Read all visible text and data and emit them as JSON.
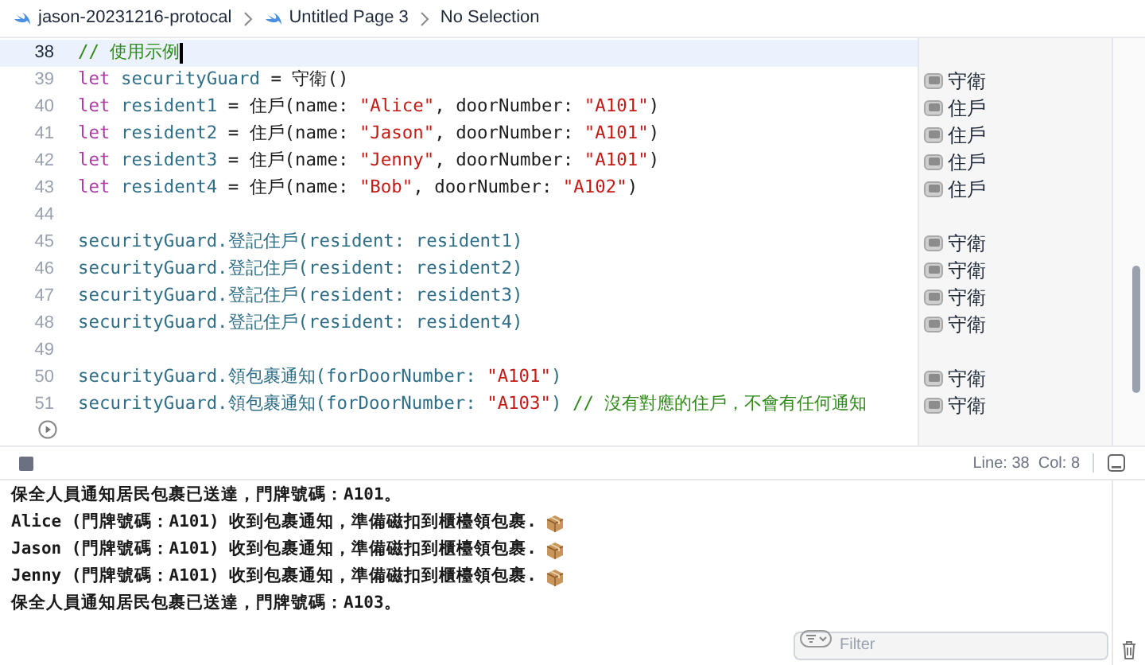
{
  "breadcrumb": [
    {
      "label": "jason-20231216-protocal",
      "icon": true
    },
    {
      "label": "Untitled Page 3",
      "icon": true
    },
    {
      "label": "No Selection",
      "icon": false
    }
  ],
  "editor": {
    "lines": [
      {
        "number": "38",
        "selected": true,
        "cursor": true,
        "tokens": [
          {
            "kind": "comment",
            "text": "// 使用示例"
          }
        ]
      },
      {
        "number": "39",
        "selected": false,
        "tokens": [
          {
            "kind": "keyword",
            "text": "let "
          },
          {
            "kind": "identifier",
            "text": "securityGuard"
          },
          {
            "kind": "plain",
            "text": " = 守衛()"
          }
        ],
        "result": "守衛"
      },
      {
        "number": "40",
        "selected": false,
        "tokens": [
          {
            "kind": "keyword",
            "text": "let "
          },
          {
            "kind": "identifier",
            "text": "resident1"
          },
          {
            "kind": "plain",
            "text": " = 住戶(name: "
          },
          {
            "kind": "string",
            "text": "\"Alice\""
          },
          {
            "kind": "plain",
            "text": ", doorNumber: "
          },
          {
            "kind": "string",
            "text": "\"A101\""
          },
          {
            "kind": "plain",
            "text": ")"
          }
        ],
        "result": "住戶"
      },
      {
        "number": "41",
        "selected": false,
        "tokens": [
          {
            "kind": "keyword",
            "text": "let "
          },
          {
            "kind": "identifier",
            "text": "resident2"
          },
          {
            "kind": "plain",
            "text": " = 住戶(name: "
          },
          {
            "kind": "string",
            "text": "\"Jason\""
          },
          {
            "kind": "plain",
            "text": ", doorNumber: "
          },
          {
            "kind": "string",
            "text": "\"A101\""
          },
          {
            "kind": "plain",
            "text": ")"
          }
        ],
        "result": "住戶"
      },
      {
        "number": "42",
        "selected": false,
        "tokens": [
          {
            "kind": "keyword",
            "text": "let "
          },
          {
            "kind": "identifier",
            "text": "resident3"
          },
          {
            "kind": "plain",
            "text": " = 住戶(name: "
          },
          {
            "kind": "string",
            "text": "\"Jenny\""
          },
          {
            "kind": "plain",
            "text": ", doorNumber: "
          },
          {
            "kind": "string",
            "text": "\"A101\""
          },
          {
            "kind": "plain",
            "text": ")"
          }
        ],
        "result": "住戶"
      },
      {
        "number": "43",
        "selected": false,
        "tokens": [
          {
            "kind": "keyword",
            "text": "let "
          },
          {
            "kind": "identifier",
            "text": "resident4"
          },
          {
            "kind": "plain",
            "text": " = 住戶(name: "
          },
          {
            "kind": "string",
            "text": "\"Bob\""
          },
          {
            "kind": "plain",
            "text": ", doorNumber: "
          },
          {
            "kind": "string",
            "text": "\"A102\""
          },
          {
            "kind": "plain",
            "text": ")"
          }
        ],
        "result": "住戶"
      },
      {
        "number": "44",
        "selected": false
      },
      {
        "number": "45",
        "selected": false,
        "tokens": [
          {
            "kind": "call",
            "text": "securityGuard.登記住戶(resident: resident1)"
          }
        ],
        "result": "守衛"
      },
      {
        "number": "46",
        "selected": false,
        "tokens": [
          {
            "kind": "call",
            "text": "securityGuard.登記住戶(resident: resident2)"
          }
        ],
        "result": "守衛"
      },
      {
        "number": "47",
        "selected": false,
        "tokens": [
          {
            "kind": "call",
            "text": "securityGuard.登記住戶(resident: resident3)"
          }
        ],
        "result": "守衛"
      },
      {
        "number": "48",
        "selected": false,
        "tokens": [
          {
            "kind": "call",
            "text": "securityGuard.登記住戶(resident: resident4)"
          }
        ],
        "result": "守衛"
      },
      {
        "number": "49",
        "selected": false
      },
      {
        "number": "50",
        "selected": false,
        "tokens": [
          {
            "kind": "call",
            "text": "securityGuard.領包裹通知(forDoorNumber: "
          },
          {
            "kind": "string",
            "text": "\"A101\""
          },
          {
            "kind": "call",
            "text": ")"
          }
        ],
        "result": "守衛"
      },
      {
        "number": "51",
        "selected": false,
        "tokens": [
          {
            "kind": "call",
            "text": "securityGuard.領包裹通知(forDoorNumber: "
          },
          {
            "kind": "string",
            "text": "\"A103\""
          },
          {
            "kind": "call",
            "text": ")"
          },
          {
            "kind": "comment",
            "text": " // 沒有對應的住戶，不會有任何通知"
          }
        ],
        "result": "守衛"
      }
    ]
  },
  "status": {
    "position": "Line: 38  Col: 8"
  },
  "console": {
    "lines": [
      {
        "text": "保全人員通知居民包裹已送達，門牌號碼：A101。",
        "package": false
      },
      {
        "text": "Alice (門牌號碼：A101) 收到包裹通知，準備磁扣到櫃檯領包裹.",
        "package": true
      },
      {
        "text": "Jason (門牌號碼：A101) 收到包裹通知，準備磁扣到櫃檯領包裹.",
        "package": true
      },
      {
        "text": "Jenny (門牌號碼：A101) 收到包裹通知，準備磁扣到櫃檯領包裹.",
        "package": true
      },
      {
        "text": "保全人員通知居民包裹已送達，門牌號碼：A103。",
        "package": false
      }
    ]
  },
  "filter": {
    "placeholder": "Filter"
  }
}
